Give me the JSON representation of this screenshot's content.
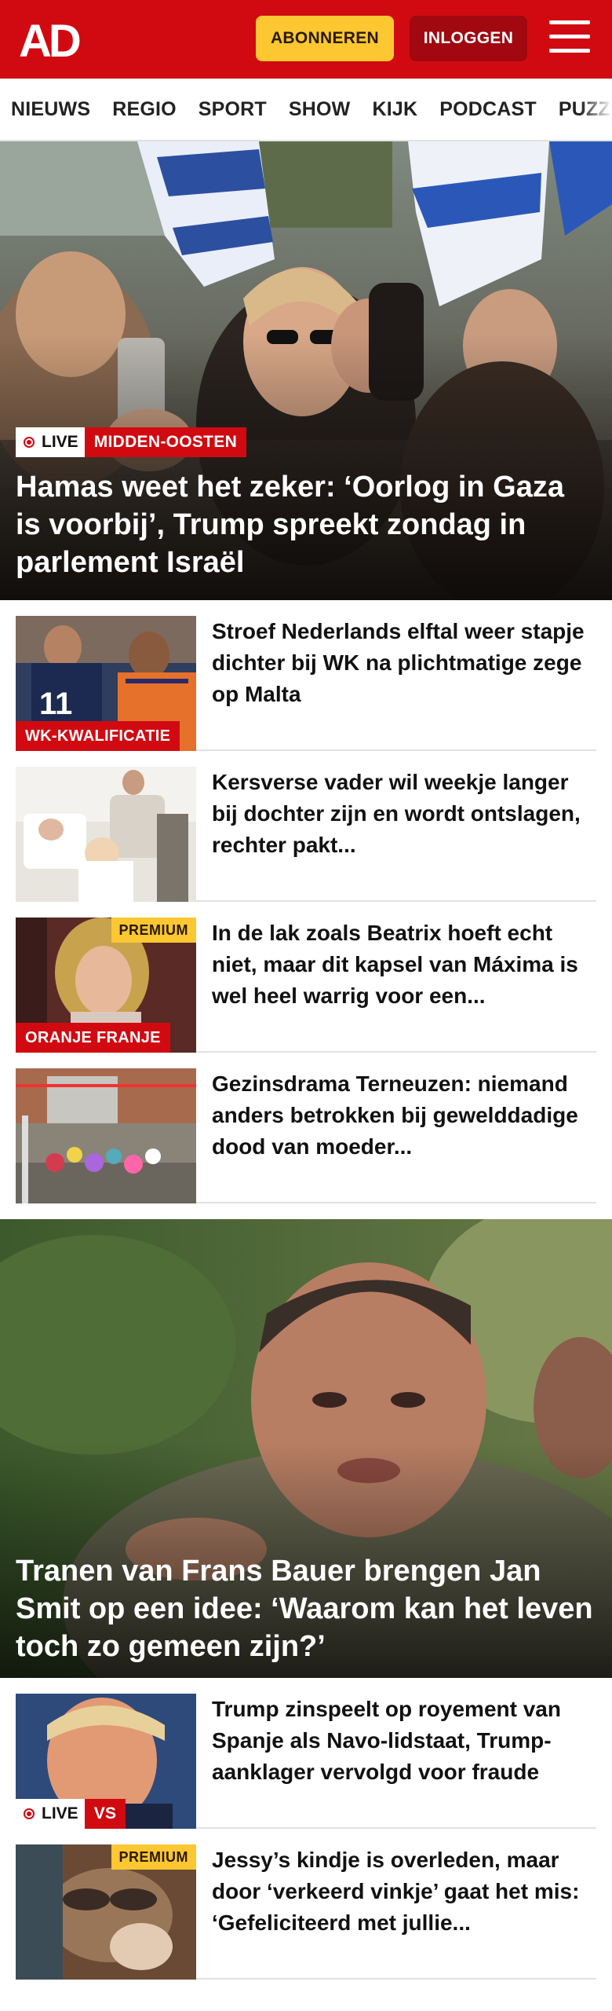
{
  "header": {
    "logo_text": "AD",
    "subscribe_label": "ABONNEREN",
    "login_label": "INLOGGEN",
    "menu_icon": "hamburger-menu-icon",
    "brand_color": "#d10a11",
    "accent_color": "#fcc731"
  },
  "nav": {
    "items": [
      "NIEUWS",
      "REGIO",
      "SPORT",
      "SHOW",
      "KIJK",
      "PODCAST",
      "PUZZ"
    ]
  },
  "hero": {
    "live_label": "LIVE",
    "section_label": "MIDDEN-OOSTEN",
    "title": "Hamas weet het zeker: ‘Oorlog in Gaza is voorbij’, Trump spreekt zondag in parlement Israël"
  },
  "articles": [
    {
      "title": "Stroef Nederlands elftal weer stapje dichter bij WK na plichtmatige zege op Malta",
      "tag": "WK-KWALIFICATIE",
      "premium": ""
    },
    {
      "title": "Kersverse vader wil weekje langer bij dochter zijn en wordt ontslagen, rechter pakt...",
      "tag": "",
      "premium": ""
    },
    {
      "title": "In de lak zoals Beatrix hoeft echt niet, maar dit kapsel van Máxima is wel heel warrig voor een...",
      "tag": "ORANJE FRANJE",
      "premium": "PREMIUM"
    },
    {
      "title": "Gezinsdrama Terneuzen: niemand anders betrokken bij gewelddadige dood van moeder...",
      "tag": "",
      "premium": ""
    }
  ],
  "feature": {
    "title": "Tranen van Frans Bauer brengen Jan Smit op een idee: ‘Waarom kan het leven toch zo gemeen zijn?’"
  },
  "articles2": [
    {
      "title": "Trump zinspeelt op royement van Spanje als Navo-lidstaat, Trump-aanklager vervolgd voor fraude",
      "live": "LIVE",
      "tag": "VS",
      "premium": ""
    },
    {
      "title": "Jessy’s kindje is overleden, maar door ‘verkeerd vinkje’ gaat het mis: ‘Gefeliciteerd met jullie...",
      "tag": "",
      "premium": "PREMIUM"
    }
  ]
}
